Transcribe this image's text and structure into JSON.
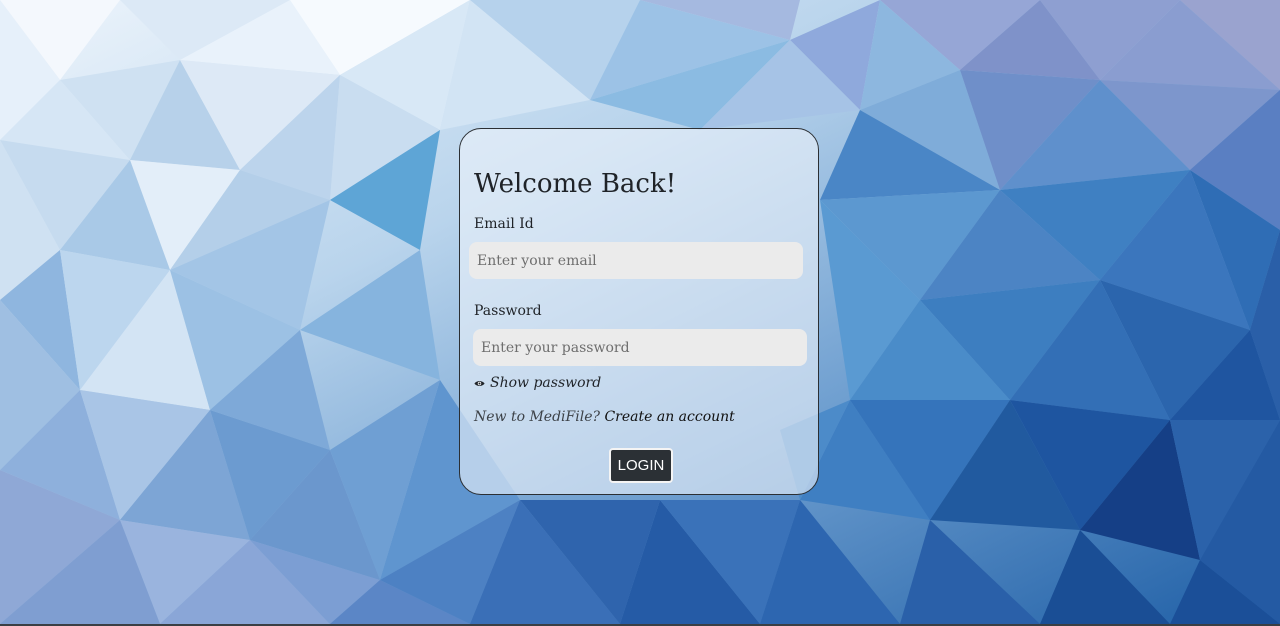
{
  "colors": {
    "card_border": "#2b2f33",
    "input_bg": "#ebebeb",
    "button_bg": "#2b3035",
    "button_text": "#ffffff"
  },
  "login_card": {
    "title": "Welcome Back!",
    "email": {
      "label": "Email Id",
      "placeholder": "Enter your email",
      "value": ""
    },
    "password": {
      "label": "Password",
      "placeholder": "Enter your password",
      "value": ""
    },
    "show_password": {
      "icon": "eye-icon",
      "label": "Show password"
    },
    "signup_prompt": {
      "text": "New to MediFile?",
      "link_label": "Create an account"
    },
    "login_button_label": "LOGIN"
  }
}
